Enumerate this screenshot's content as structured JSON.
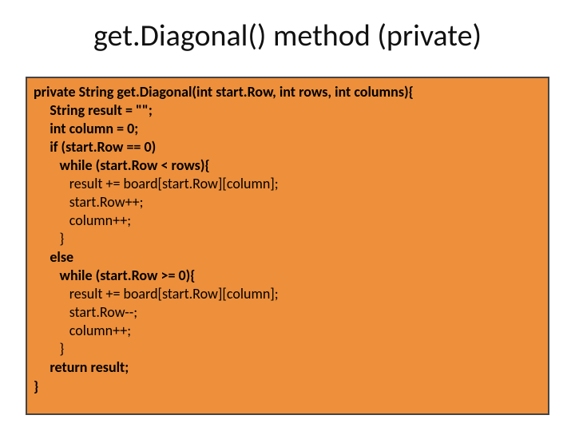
{
  "slide": {
    "title": "get.Diagonal() method (private)"
  },
  "code": {
    "l0": "private String get.Diagonal(int start.Row, int rows, int columns){",
    "l1": "     String result = \"\";",
    "l2": "     int column = 0;",
    "l3": "     if (start.Row == 0)",
    "l4": "        while (start.Row < rows){",
    "l5": "           result += board[start.Row][column];",
    "l6": "           start.Row++;",
    "l7": "           column++;",
    "l8": "        }",
    "l9": "     else",
    "l10": "        while (start.Row >= 0){",
    "l11": "           result += board[start.Row][column];",
    "l12": "           start.Row--;",
    "l13": "           column++;",
    "l14": "        }",
    "l15": "     return result;",
    "l16": "}"
  }
}
